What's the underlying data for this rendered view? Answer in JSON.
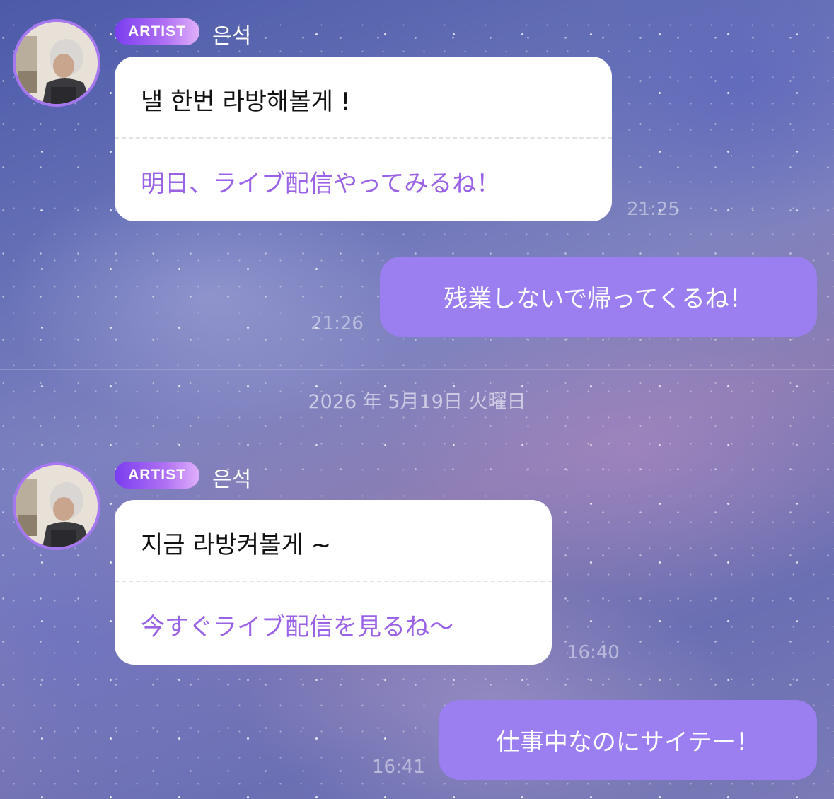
{
  "messages": [
    {
      "type": "incoming",
      "badge": "ARTIST",
      "sender": "은석",
      "original": "낼 한번 라방해볼게 !",
      "translation": "明日、ライブ配信やってみるね！",
      "time": "21:25"
    },
    {
      "type": "outgoing",
      "text": "残業しないで帰ってくるね！",
      "time": "21:26"
    },
    {
      "type": "incoming",
      "badge": "ARTIST",
      "sender": "은석",
      "original": "지금 라방켜볼게 ~",
      "translation": "今すぐライブ配信を見るね〜",
      "time": "16:40"
    },
    {
      "type": "outgoing",
      "text": "仕事中なのにサイテー！",
      "time": "16:41"
    }
  ],
  "date_divider": "2026 年 5月19日 火曜日",
  "colors": {
    "accent": "#9b7ef0",
    "translation_text": "#9a63e6",
    "badge_gradient_start": "#7a3df0",
    "avatar_ring": "#a777f0"
  }
}
